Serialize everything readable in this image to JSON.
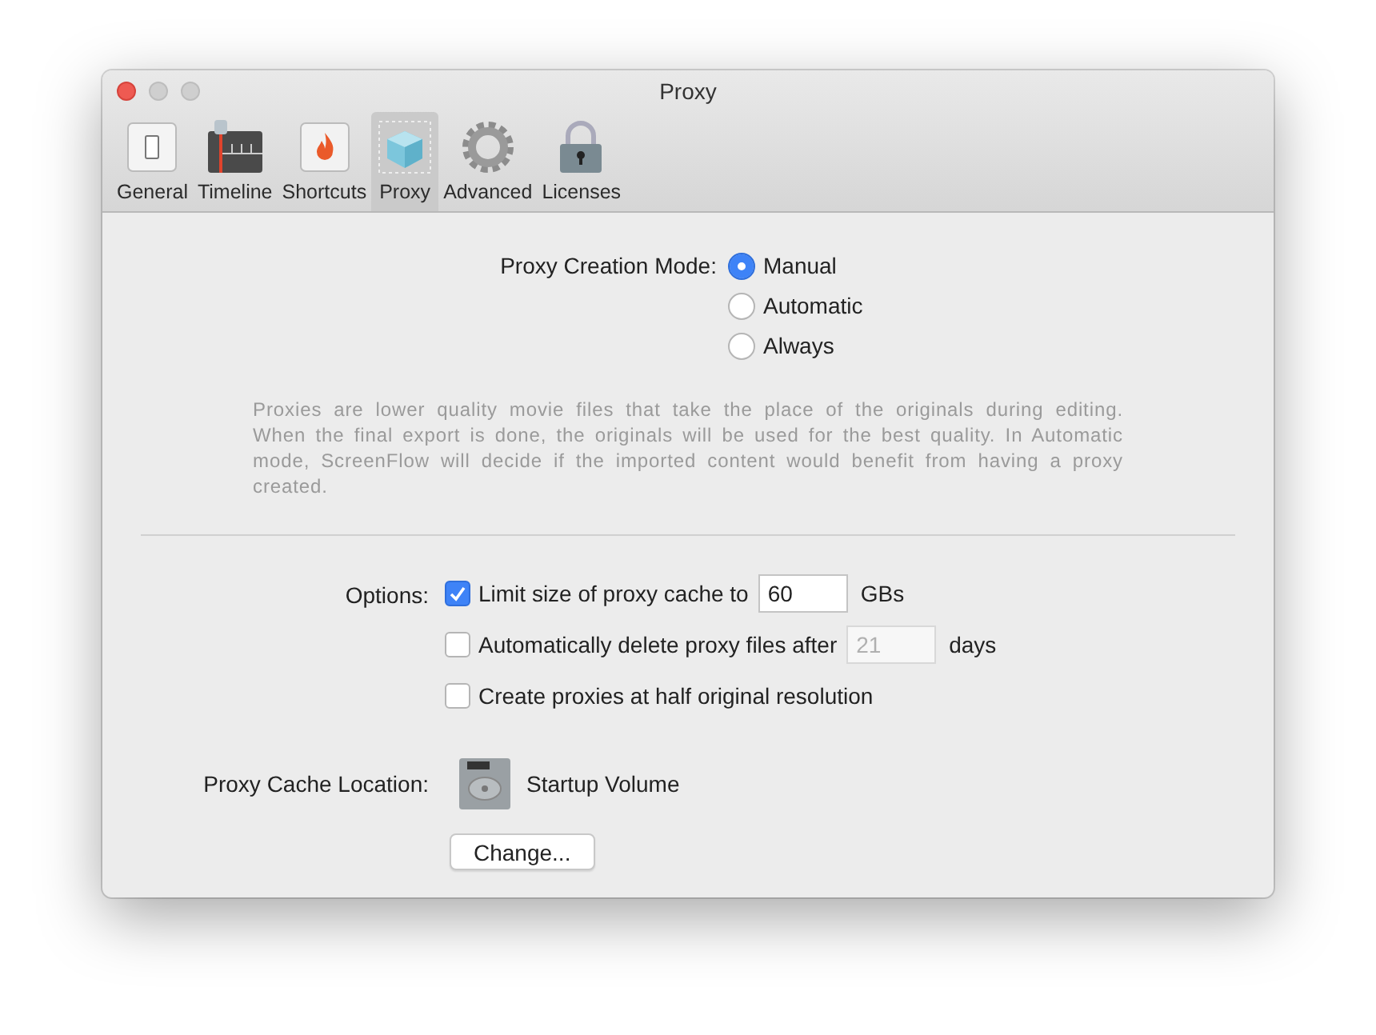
{
  "window": {
    "title": "Proxy"
  },
  "tabs": [
    {
      "label": "General",
      "kind": "switch",
      "selected": false
    },
    {
      "label": "Timeline",
      "kind": "timeline",
      "selected": false
    },
    {
      "label": "Shortcuts",
      "kind": "flame",
      "selected": false
    },
    {
      "label": "Proxy",
      "kind": "cube",
      "selected": true
    },
    {
      "label": "Advanced",
      "kind": "gear",
      "selected": false
    },
    {
      "label": "Licenses",
      "kind": "lock",
      "selected": false
    }
  ],
  "creation_mode": {
    "label": "Proxy Creation Mode:",
    "options": [
      {
        "label": "Manual",
        "selected": true
      },
      {
        "label": "Automatic",
        "selected": false
      },
      {
        "label": "Always",
        "selected": false
      }
    ]
  },
  "description": "Proxies are lower quality movie files that take the place of the originals during editing. When the final export is done, the originals will be used for the best quality.  In Automatic mode, ScreenFlow will decide if the imported content would benefit from having a proxy created.",
  "options": {
    "label": "Options:",
    "items": [
      {
        "label": "Limit size of proxy cache to",
        "checked": true,
        "field": {
          "value": "60",
          "disabled": false
        },
        "suffix": "GBs"
      },
      {
        "label": "Automatically delete proxy files after",
        "checked": false,
        "field": {
          "value": "21",
          "disabled": true
        },
        "suffix": "days"
      },
      {
        "label": "Create proxies at half original resolution",
        "checked": false
      }
    ]
  },
  "cache_location": {
    "label": "Proxy Cache Location:",
    "volume": "Startup Volume",
    "button": "Change..."
  }
}
